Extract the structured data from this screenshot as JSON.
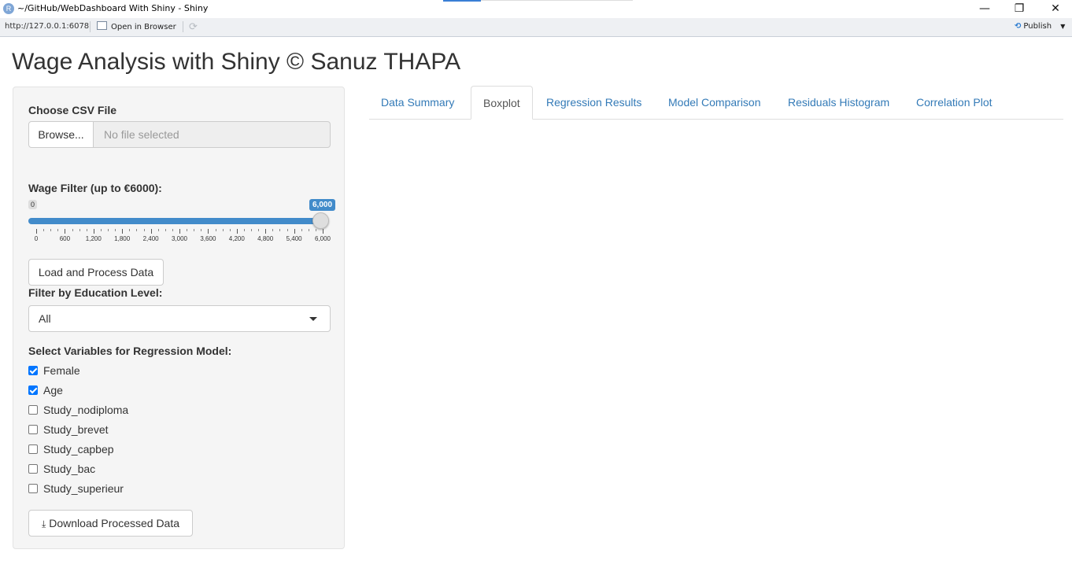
{
  "window": {
    "title": "~/GitHub/WebDashboard With Shiny - Shiny",
    "app_icon": "R",
    "minimize": "—",
    "restore": "❐",
    "close": "✕"
  },
  "addressbar": {
    "url": "http://127.0.0.1:6078",
    "open_in_browser": "Open in Browser",
    "publish": "Publish"
  },
  "page": {
    "title": "Wage Analysis with Shiny © Sanuz THAPA"
  },
  "sidebar": {
    "file_label": "Choose CSV File",
    "browse_label": "Browse...",
    "file_placeholder": "No file selected",
    "wage_label": "Wage Filter (up to €6000):",
    "slider": {
      "min_label": "0",
      "value_label": "6,000",
      "value_fraction": 1.0,
      "ticks": [
        "0",
        "600",
        "1,200",
        "1,800",
        "2,400",
        "3,000",
        "3,600",
        "4,200",
        "4,800",
        "5,400",
        "6,000"
      ]
    },
    "load_button": "Load and Process Data",
    "education_label": "Filter by Education Level:",
    "education_selected": "All",
    "variables_label": "Select Variables for Regression Model:",
    "variables": [
      {
        "label": "Female",
        "checked": true
      },
      {
        "label": "Age",
        "checked": true
      },
      {
        "label": "Study_nodiploma",
        "checked": false
      },
      {
        "label": "Study_brevet",
        "checked": false
      },
      {
        "label": "Study_capbep",
        "checked": false
      },
      {
        "label": "Study_bac",
        "checked": false
      },
      {
        "label": "Study_superieur",
        "checked": false
      }
    ],
    "download_button": "Download Processed Data"
  },
  "tabs": [
    {
      "label": "Data Summary",
      "active": false
    },
    {
      "label": "Boxplot",
      "active": true
    },
    {
      "label": "Regression Results",
      "active": false
    },
    {
      "label": "Model Comparison",
      "active": false
    },
    {
      "label": "Residuals Histogram",
      "active": false
    },
    {
      "label": "Correlation Plot",
      "active": false
    }
  ]
}
